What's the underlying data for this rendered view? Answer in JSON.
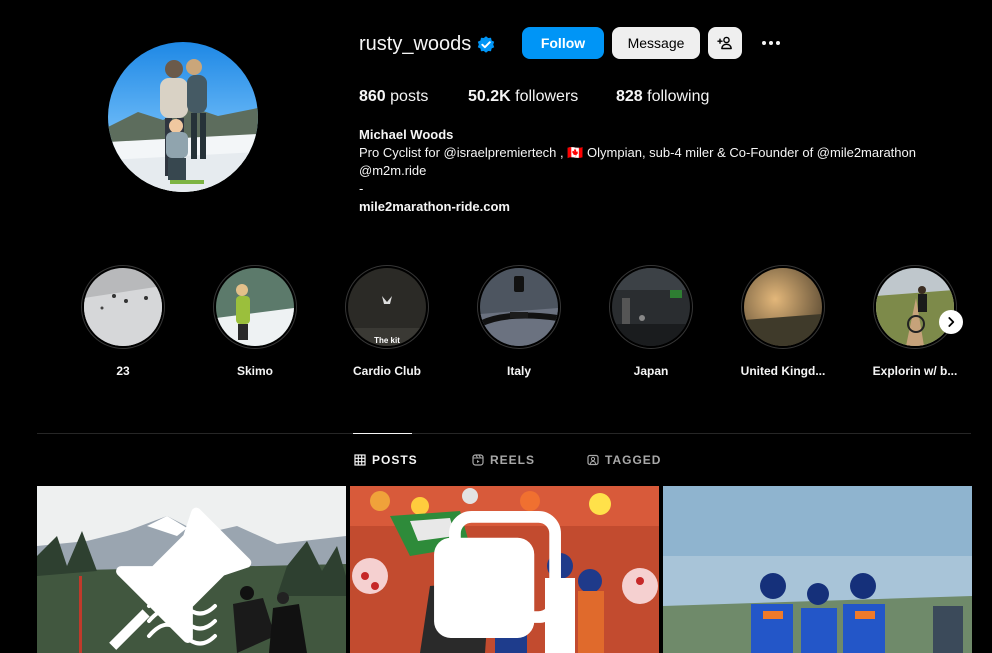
{
  "profile": {
    "username": "rusty_woods",
    "verified": true,
    "follow_label": "Follow",
    "message_label": "Message",
    "stats": {
      "posts_count": "860",
      "posts_label": " posts",
      "followers_count": "50.2K",
      "followers_label": " followers",
      "following_count": "828",
      "following_label": " following"
    },
    "bio": {
      "name": "Michael Woods",
      "line1": "Pro Cyclist for @israelpremiertech , 🇨🇦 Olympian, sub-4 miler & Co-Founder of @mile2marathon",
      "line2": "@m2m.ride",
      "line3": "-",
      "link": "mile2marathon-ride.com"
    }
  },
  "highlights": [
    {
      "label": "23"
    },
    {
      "label": "Skimo"
    },
    {
      "label": "Cardio Club"
    },
    {
      "label": "Italy"
    },
    {
      "label": "Japan"
    },
    {
      "label": "United Kingd..."
    },
    {
      "label": "Explorin w/ b..."
    }
  ],
  "highlight_inner_text": "The kit",
  "tabs": [
    {
      "label": "POSTS",
      "icon": "grid-icon",
      "active": true
    },
    {
      "label": "REELS",
      "icon": "reels-icon",
      "active": false
    },
    {
      "label": "TAGGED",
      "icon": "tagged-icon",
      "active": false
    }
  ],
  "colors": {
    "accent": "#0095f6",
    "background": "#000000",
    "text": "#f5f5f5",
    "muted": "#a8a8a8"
  }
}
